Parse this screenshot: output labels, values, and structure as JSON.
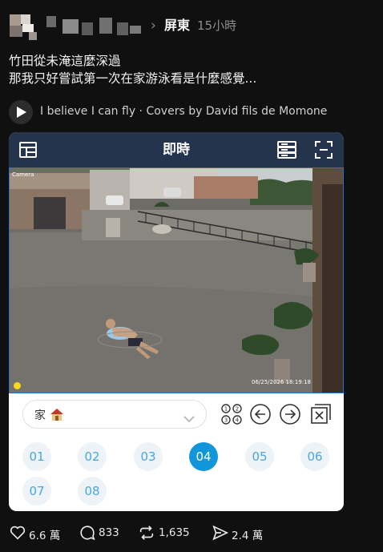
{
  "header": {
    "location": "屏東",
    "time": "15小時"
  },
  "post": {
    "line1": "竹田從未淹這麼深過",
    "line2": "那我只好嘗試第一次在家游泳看是什麼感覺..."
  },
  "music": {
    "label": "I believe I can fly · Covers by David fils de Momone"
  },
  "app": {
    "title": "即時",
    "camera_label": "Camera",
    "timestamp": "06/25/2026 18:19:18",
    "dropdown_value": "家",
    "channels": [
      "01",
      "02",
      "03",
      "04",
      "05",
      "06",
      "07",
      "08"
    ],
    "active_channel": "04",
    "accent_color": "#1296db",
    "bar_color": "#24344d"
  },
  "actions": {
    "likes": "6.6 萬",
    "comments": "833",
    "reposts": "1,635",
    "shares": "2.4 萬"
  }
}
